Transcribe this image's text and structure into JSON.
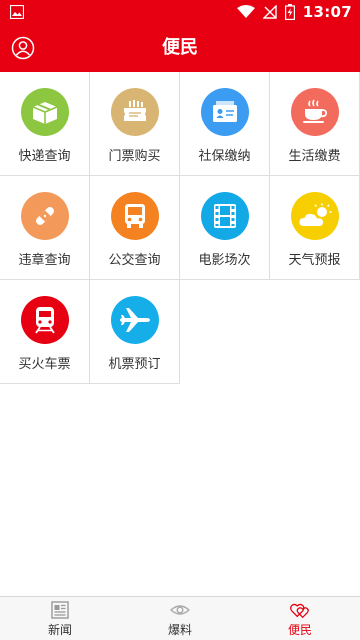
{
  "status_bar": {
    "time": "13:07"
  },
  "header": {
    "title": "便民"
  },
  "services": [
    {
      "label": "快递查询",
      "icon": "package-icon",
      "color": "#8dc641"
    },
    {
      "label": "门票购买",
      "icon": "ticket-icon",
      "color": "#d9b574"
    },
    {
      "label": "社保缴纳",
      "icon": "id-card-icon",
      "color": "#3b9cf2"
    },
    {
      "label": "生活缴费",
      "icon": "coffee-cup-icon",
      "color": "#f26b5c"
    },
    {
      "label": "违章查询",
      "icon": "bandage-icon",
      "color": "#f39a5a"
    },
    {
      "label": "公交查询",
      "icon": "bus-icon",
      "color": "#f58220"
    },
    {
      "label": "电影场次",
      "icon": "film-icon",
      "color": "#12a9e6"
    },
    {
      "label": "天气预报",
      "icon": "weather-icon",
      "color": "#f7cf00"
    },
    {
      "label": "买火车票",
      "icon": "train-icon",
      "color": "#e60012"
    },
    {
      "label": "机票预订",
      "icon": "airplane-icon",
      "color": "#16aee8"
    }
  ],
  "tabbar": {
    "tabs": [
      {
        "label": "新闻",
        "icon": "newspaper-icon",
        "active": false
      },
      {
        "label": "爆料",
        "icon": "eye-icon",
        "active": false
      },
      {
        "label": "便民",
        "icon": "hearts-icon",
        "active": true
      }
    ],
    "active_color": "#e60012"
  }
}
